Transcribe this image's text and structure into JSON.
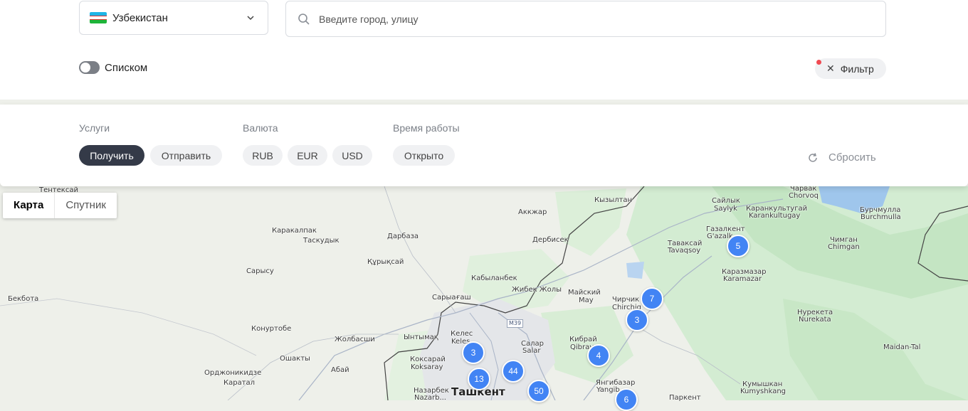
{
  "country_select": {
    "flag_icon": "uzbekistan-flag-icon",
    "value": "Узбекистан",
    "icon": "chevron-down-icon"
  },
  "search": {
    "icon": "search-icon",
    "placeholder": "Введите город, улицу",
    "value": ""
  },
  "view_toggle": {
    "label": "Списком",
    "on": false
  },
  "filter_button": {
    "icon": "close-icon",
    "label": "Фильтр",
    "badge_color": "#f04a52"
  },
  "filters": {
    "services": {
      "title": "Услуги",
      "options": [
        {
          "label": "Получить",
          "active": true
        },
        {
          "label": "Отправить",
          "active": false
        }
      ]
    },
    "currency": {
      "title": "Валюта",
      "options": [
        {
          "label": "RUB",
          "active": false
        },
        {
          "label": "EUR",
          "active": false
        },
        {
          "label": "USD",
          "active": false
        }
      ]
    },
    "hours": {
      "title": "Время работы",
      "options": [
        {
          "label": "Открыто",
          "active": false
        }
      ]
    },
    "reset": {
      "icon": "refresh-icon",
      "label": "Сбросить"
    }
  },
  "map_type": {
    "options": [
      "Карта",
      "Спутник"
    ],
    "selected": "Карта"
  },
  "colors": {
    "active_chip": "#343a48",
    "cluster": "#4284f4",
    "flag": [
      "#1eb5e6",
      "#ffffff",
      "#1eb53a"
    ]
  },
  "map": {
    "places": [
      "Тентексай",
      "Аккжар",
      "Каракалпак",
      "Таскудык",
      "Дарбаза",
      "Дербисек",
      "Кызылтан",
      "Сайлык",
      "Saylyk",
      "Каранкультугай",
      "Karankultugay",
      "Чарвак",
      "Chorvoq",
      "Бурчмулла",
      "Burchmulla",
      "Газалкент",
      "G'azalk...",
      "Таваксай",
      "Tavaqsoy",
      "Чимган",
      "Chimgan",
      "Сарысу",
      "Құрықсай",
      "Кабыланбек",
      "Бекбота",
      "Сарыағаш",
      "Жибек Жолы",
      "Майский",
      "May",
      "Каразмазар",
      "Karamazar",
      "Чирчик",
      "Chirchiq",
      "Нурекета",
      "Nurekata",
      "Конуртобе",
      "Ынтымақ",
      "Келес",
      "Keles",
      "Салар",
      "Salar",
      "Кибрай",
      "Qibray",
      "Жолбасши",
      "Ошакты",
      "Абай",
      "Коксарай",
      "Koksaray",
      "Орджоникидзе",
      "Каратал",
      "Назарбек",
      "Nazarb...",
      "Ташкент",
      "Янгибазар",
      "Yangib...",
      "Паркент",
      "Кумышкан",
      "Kumyshkang",
      "Maidan-Tal"
    ],
    "road_label": "M39",
    "clusters": [
      "5",
      "7",
      "3",
      "3",
      "44",
      "13",
      "4",
      "50",
      "6"
    ]
  }
}
